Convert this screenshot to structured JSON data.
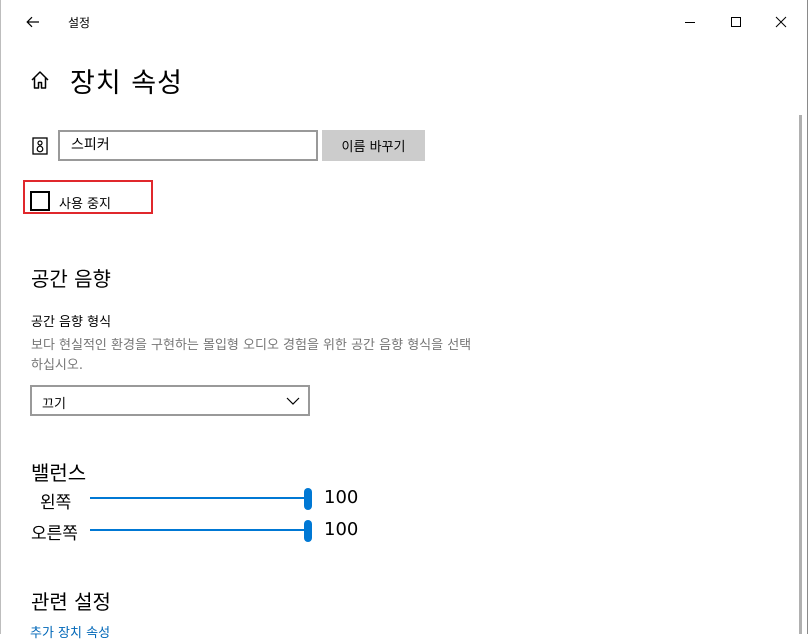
{
  "window": {
    "title": "설정",
    "back_icon": "back-arrow-icon",
    "minimize_icon": "minimize-icon",
    "maximize_icon": "maximize-icon",
    "close_icon": "close-icon"
  },
  "page": {
    "home_icon": "home-icon",
    "title": "장치 속성"
  },
  "device": {
    "icon": "speaker-icon",
    "name_value": "스피커",
    "rename_label": "이름 바꾸기",
    "disable_label": "사용 중지",
    "disable_checked": false,
    "highlight_color": "#e0282c"
  },
  "spatial_sound": {
    "heading": "공간 음향",
    "format_label": "공간 음향 형식",
    "description": "보다 현실적인 환경을 구현하는 몰입형 오디오 경험을 위한 공간 음향 형식을 선택하십시오.",
    "selected": "끄기"
  },
  "balance": {
    "heading": "밸런스",
    "left_label": "왼쪽",
    "left_value": 100,
    "right_label": "오른쪽",
    "right_value": 100,
    "accent": "#0078d4"
  },
  "related": {
    "heading": "관련 설정",
    "link": "추가 장치 속성"
  }
}
